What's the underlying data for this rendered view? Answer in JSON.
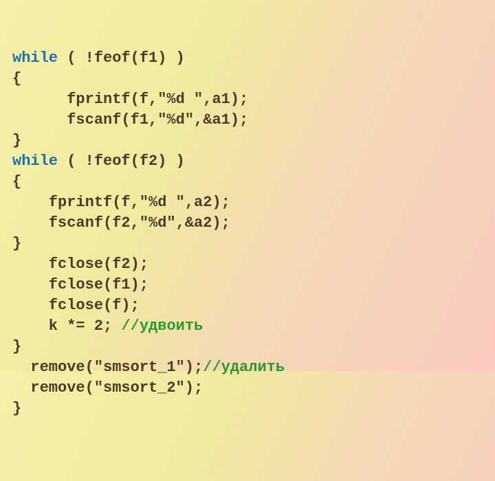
{
  "code": {
    "l1a": "while",
    "l1b": " ( !feof(f1) )",
    "l2": "{",
    "l3": "      fprintf(f,\"%d \",a1);",
    "l4": "      fscanf(f1,\"%d\",&a1);",
    "l5": "}",
    "l6a": "while",
    "l6b": " ( !feof(f2) )",
    "l7": "{",
    "l8": "    fprintf(f,\"%d \",a2);",
    "l9": "    fscanf(f2,\"%d\",&a2);",
    "l10": "}",
    "l11": "    fclose(f2);",
    "l12": "    fclose(f1);",
    "l13": "    fclose(f);",
    "l14a": "    k *= 2;",
    "l14b": " //удвоить",
    "l15": "}",
    "l16a": "  remove(\"smsort_1\");",
    "l16b": "//удалить",
    "l17": "  remove(\"smsort_2\");",
    "l18": "}"
  }
}
